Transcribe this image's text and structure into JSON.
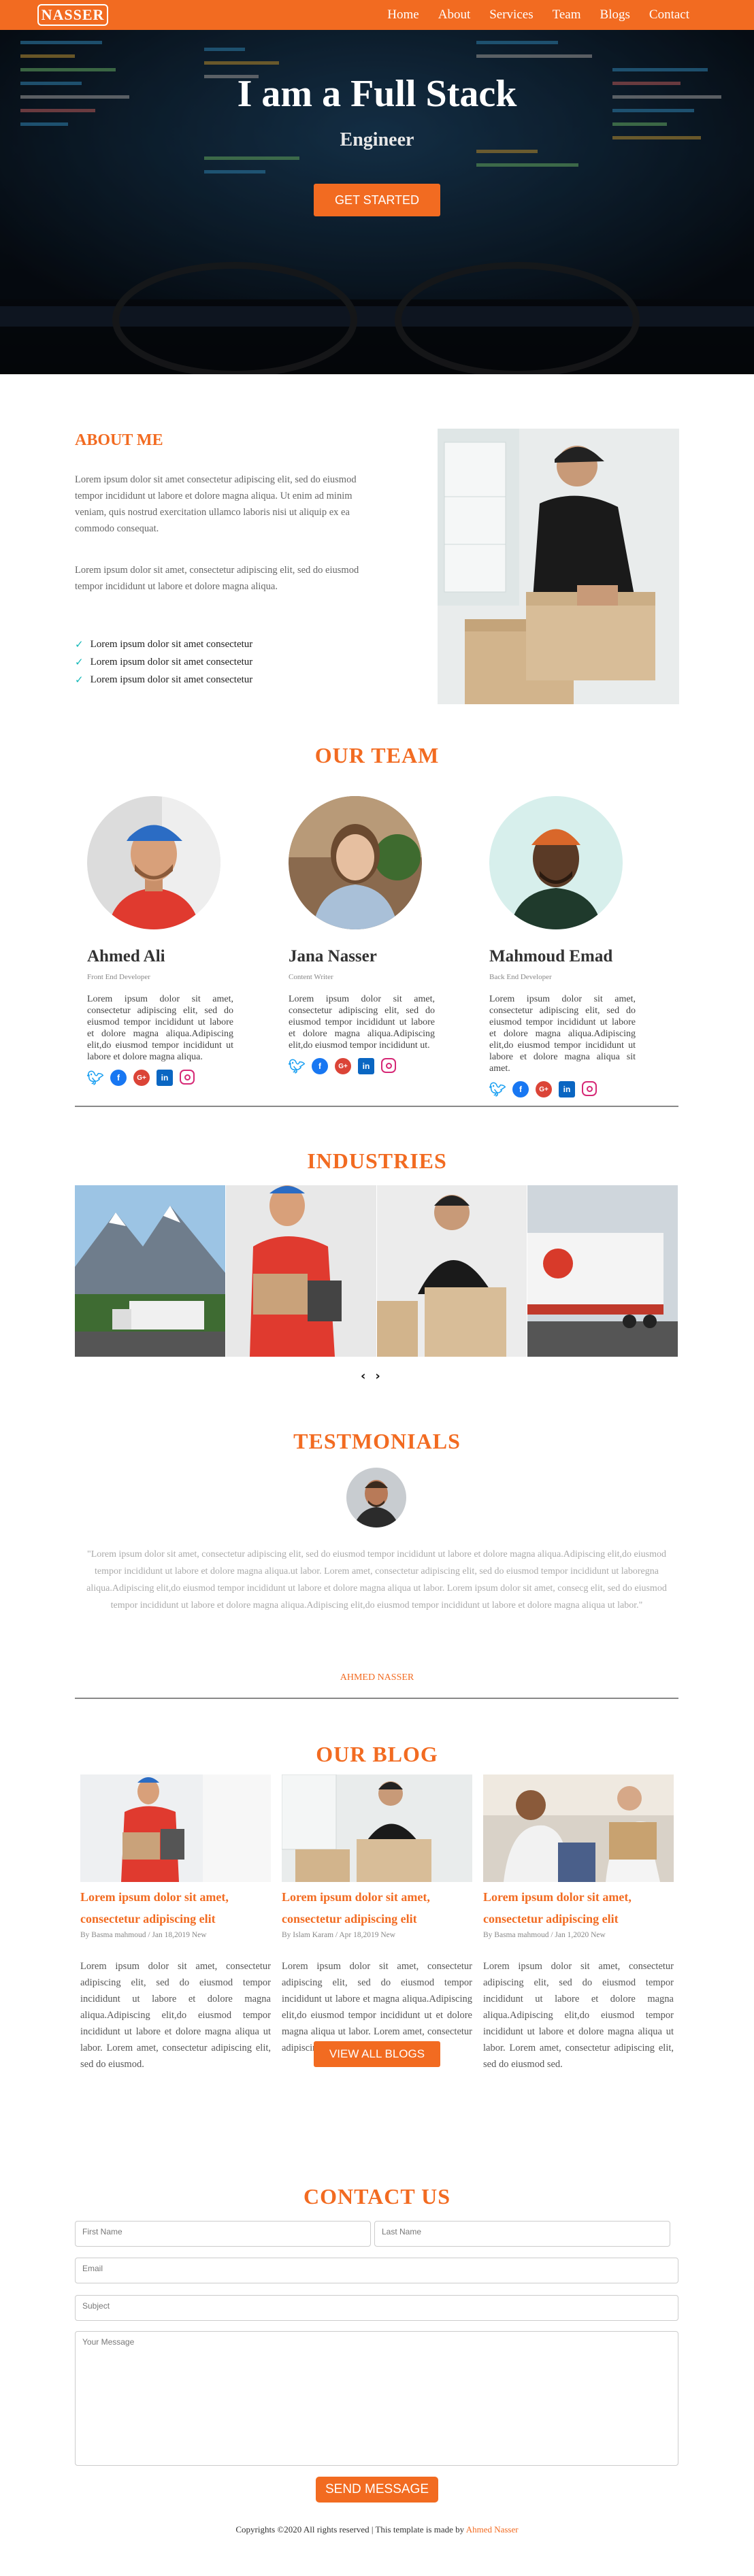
{
  "nav": {
    "logo": "NASSER",
    "links": [
      "Home",
      "About",
      "Services",
      "Team",
      "Blogs",
      "Contact"
    ]
  },
  "hero": {
    "title": "I am a Full Stack",
    "subtitle": "Engineer",
    "button": "GET STARTED"
  },
  "about": {
    "title": "ABOUT ME",
    "p1": "Lorem ipsum dolor sit amet consectetur adipiscing elit, sed do eiusmod tempor incididunt ut labore et dolore magna aliqua. Ut enim ad minim veniam, quis nostrud exercitation ullamco laboris nisi ut aliquip ex ea commodo consequat.",
    "p2": "Lorem ipsum dolor sit amet, consectetur adipiscing elit, sed do eiusmod tempor incididunt ut labore et dolore magna aliqua.",
    "checks": [
      "Lorem ipsum dolor sit amet consectetur",
      "Lorem ipsum dolor sit amet consectetur",
      "Lorem ipsum dolor sit amet consectetur"
    ]
  },
  "team": {
    "title": "OUR TEAM",
    "members": [
      {
        "name": "Ahmed Ali",
        "role": "Front End Developer",
        "bio": "Lorem ipsum dolor sit amet, consectetur adipiscing elit, sed do eiusmod tempor incididunt ut labore et dolore magna aliqua.Adipiscing elit,do eiusmod tempor incididunt ut labore et dolore magna aliqua."
      },
      {
        "name": "Jana Nasser",
        "role": "Content Writer",
        "bio": "Lorem ipsum dolor sit amet, consectetur adipiscing elit, sed do eiusmod tempor incididunt ut labore et dolore magna aliqua.Adipiscing elit,do eiusmod tempor incididunt ut."
      },
      {
        "name": "Mahmoud Emad",
        "role": "Back End Developer",
        "bio": "Lorem ipsum dolor sit amet, consectetur adipiscing elit, sed do eiusmod tempor incididunt ut labore et dolore magna aliqua.Adipiscing elit,do eiusmod tempor incididunt ut labore et dolore magna aliqua sit amet."
      }
    ]
  },
  "industries": {
    "title": "INDUSTRIES",
    "prev": "‹",
    "next": "›"
  },
  "testimonials": {
    "title": "TESTMONIALS",
    "quote": "\"Lorem ipsum dolor sit amet, consectetur adipiscing elit, sed do eiusmod tempor incididunt ut labore et dolore magna aliqua.Adipiscing elit,do eiusmod tempor incididunt ut labore et dolore magna aliqua.ut labor. Lorem amet, consectetur adipiscing elit, sed do eiusmod tempor incididunt ut laboregna aliqua.Adipiscing elit,do eiusmod tempor incididunt ut labore et dolore magna aliqua ut labor. Lorem ipsum dolor sit amet, consecg elit, sed do eiusmod tempor incididunt ut labore et dolore magna aliqua.Adipiscing elit,do eiusmod tempor incididunt ut labore et dolore magna aliqua ut labor.\"",
    "name": "AHMED NASSER"
  },
  "blog": {
    "title": "OUR BLOG",
    "posts": [
      {
        "title": "Lorem ipsum dolor sit amet, consectetur adipiscing elit",
        "meta": "By Basma mahmoud / Jan 18,2019 New",
        "body": "Lorem ipsum dolor sit amet, consectetur adipiscing elit, sed do eiusmod tempor incididunt ut labore et dolore magna aliqua.Adipiscing elit,do eiusmod tempor incididunt ut labore et dolore magna aliqua ut labor. Lorem amet, consectetur adipiscing elit, sed do eiusmod."
      },
      {
        "title": "Lorem ipsum dolor sit amet, consectetur adipiscing elit",
        "meta": "By Islam Karam / Apr 18,2019 New",
        "body": "Lorem ipsum dolor sit amet, consectetur adipiscing elit, sed do eiusmod tempor incididunt ut labore et magna aliqua.Adipiscing elit,do eiusmod tempor incididunt ut et dolore magna aliqua ut labor. Lorem amet, consectetur adipiscing elit, sed do eiusmod."
      },
      {
        "title": "Lorem ipsum dolor sit amet, consectetur adipiscing elit",
        "meta": "By Basma mahmoud / Jan 1,2020 New",
        "body": "Lorem ipsum dolor sit amet, consectetur adipiscing elit, sed do eiusmod tempor incididunt ut labore et dolore magna aliqua.Adipiscing elit,do eiusmod tempor incididunt ut labore et dolore magna aliqua ut labor. Lorem amet, consectetur adipiscing elit, sed do eiusmod sed."
      }
    ],
    "view_all": "VIEW ALL BLOGS"
  },
  "contact": {
    "title": "CONTACT US",
    "first_name": "First Name",
    "last_name": "Last Name",
    "email": "Email",
    "subject": "Subject",
    "message": "Your Message",
    "send": "SEND MESSAGE"
  },
  "footer": {
    "text": "Copyrights ©2020 All rights reserved | This template is made by ",
    "author": "Ahmed Nasser"
  },
  "colors": {
    "accent": "#f26b21",
    "check": "#13b8b8"
  }
}
